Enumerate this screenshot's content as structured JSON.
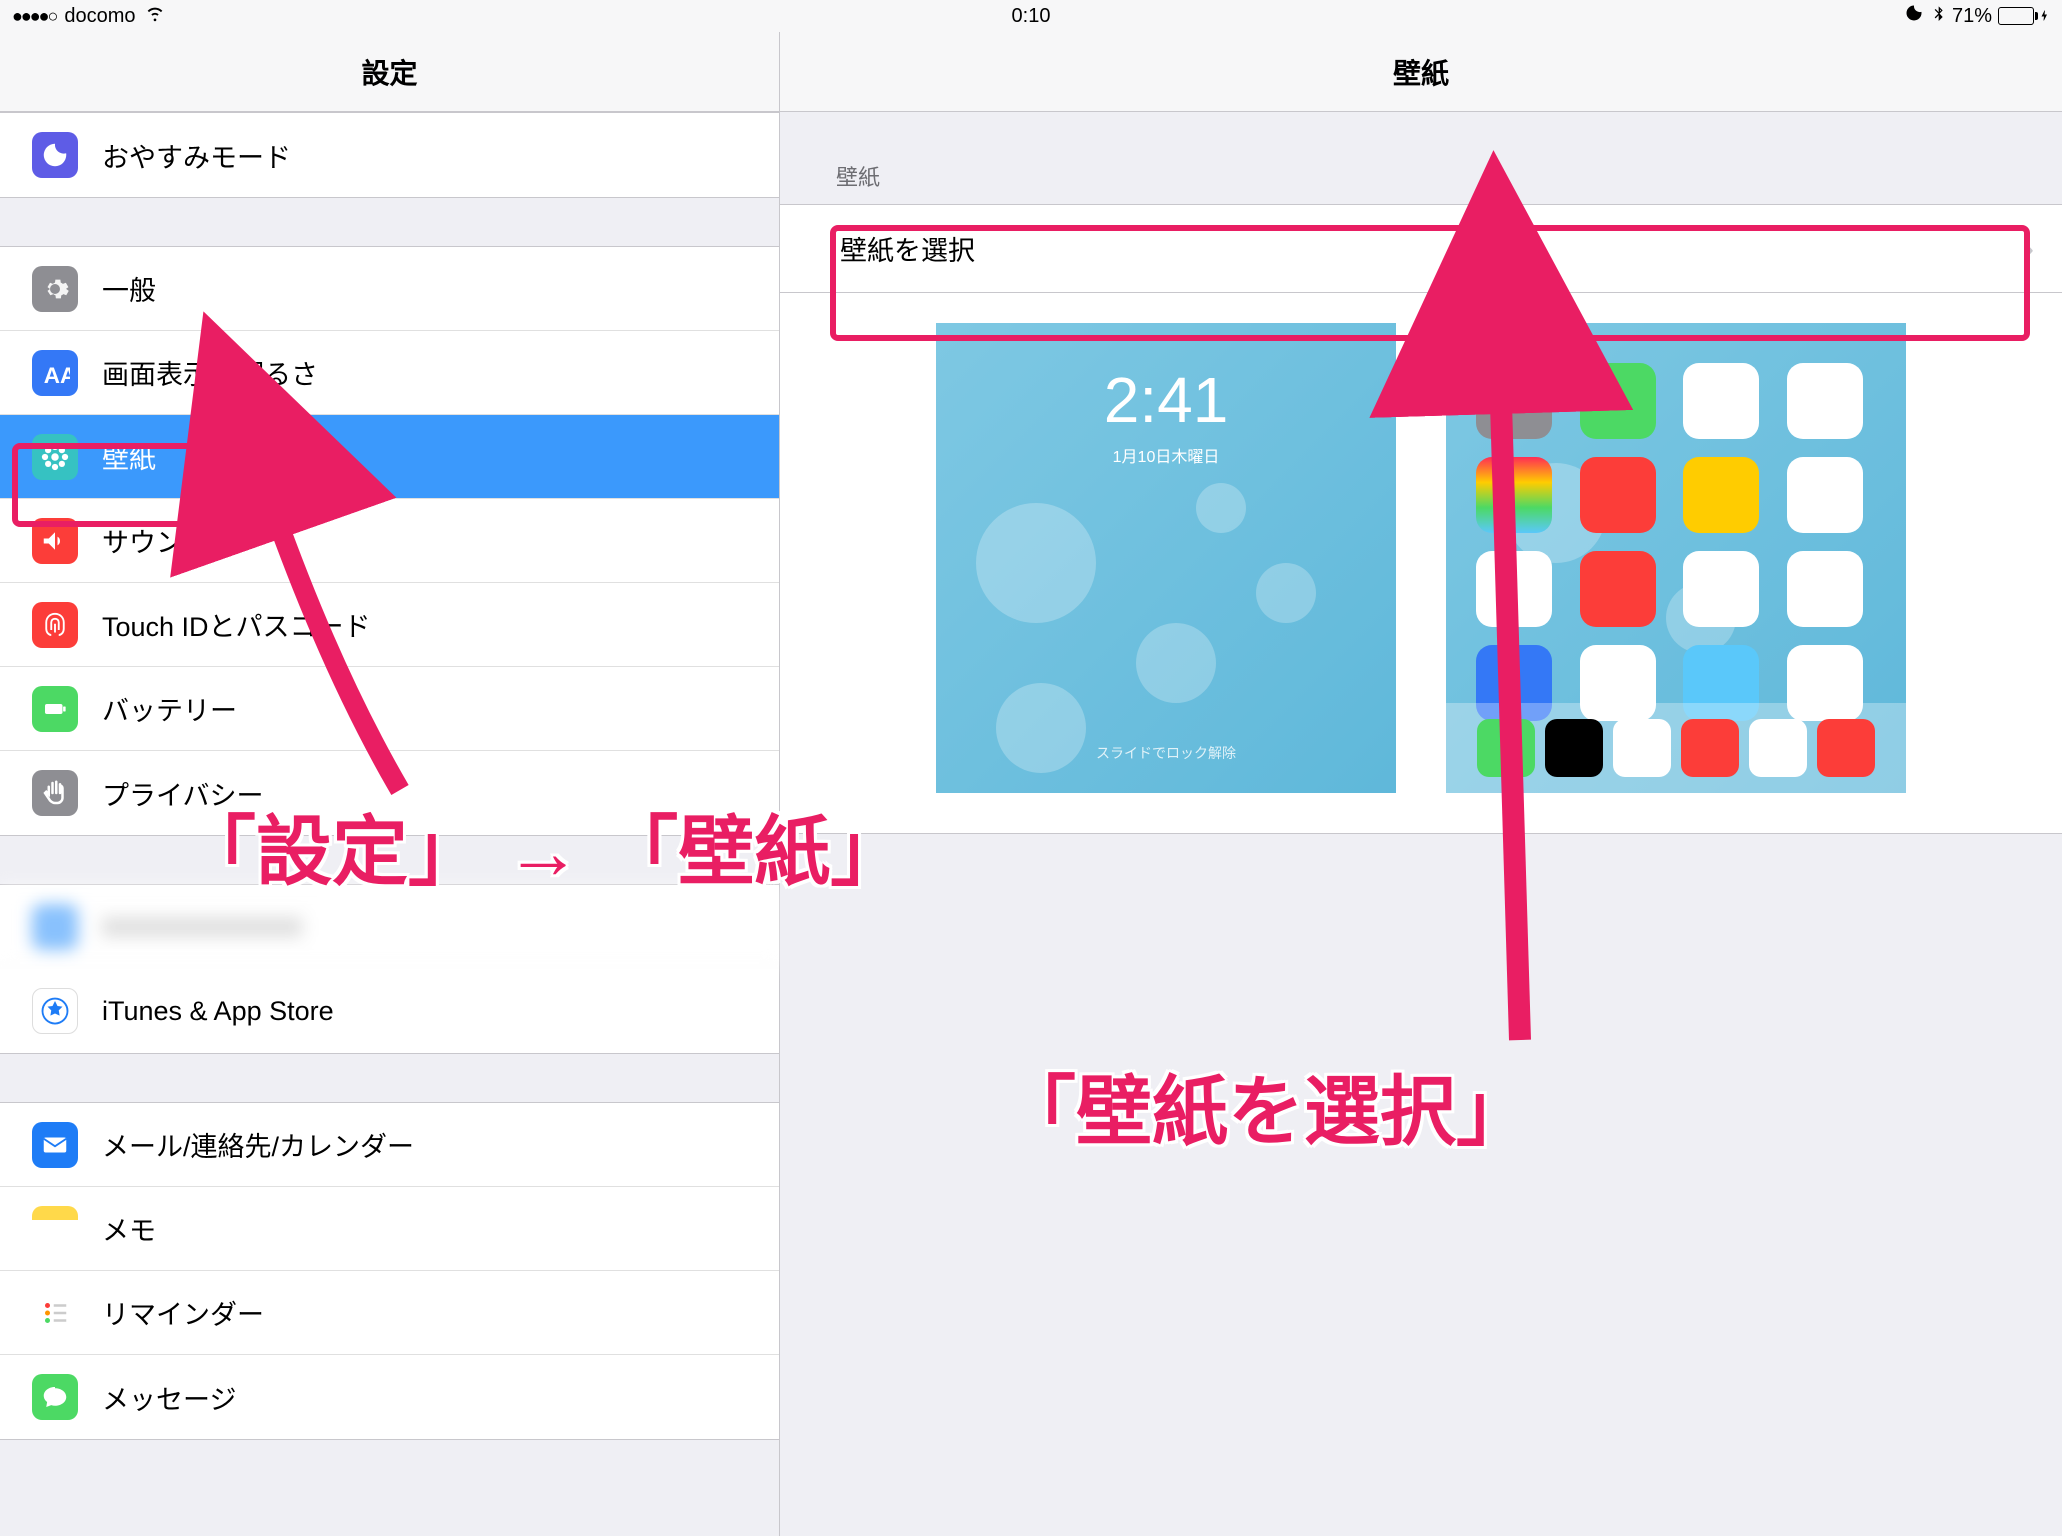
{
  "status": {
    "carrier": "docomo",
    "time": "0:10",
    "battery_pct": "71%",
    "signal_dots": "●●●●○"
  },
  "sidebar": {
    "title": "設定",
    "items": [
      {
        "label": "おやすみモード",
        "icon": "moon"
      },
      {
        "label": "一般",
        "icon": "gear"
      },
      {
        "label": "画面表示と明るさ",
        "icon": "display"
      },
      {
        "label": "壁紙",
        "icon": "wallpaper",
        "selected": true
      },
      {
        "label": "サウンド",
        "icon": "sound"
      },
      {
        "label": "Touch IDとパスコード",
        "icon": "touchid"
      },
      {
        "label": "バッテリー",
        "icon": "battery"
      },
      {
        "label": "プライバシー",
        "icon": "privacy"
      },
      {
        "label": "iCloud",
        "icon": "icloud",
        "redacted": true
      },
      {
        "label": "iTunes & App Store",
        "icon": "appstore"
      },
      {
        "label": "メール/連絡先/カレンダー",
        "icon": "mail"
      },
      {
        "label": "メモ",
        "icon": "notes"
      },
      {
        "label": "リマインダー",
        "icon": "reminders"
      },
      {
        "label": "メッセージ",
        "icon": "messages"
      }
    ]
  },
  "detail": {
    "title": "壁紙",
    "section_header": "壁紙",
    "choose_wallpaper": "壁紙を選択",
    "lock_preview": {
      "time": "2:41",
      "date": "1月10日木曜日",
      "slide": "スライドでロック解除"
    }
  },
  "annotations": {
    "breadcrumb": "「設定」 → 「壁紙」",
    "choose": "「壁紙を選択」"
  }
}
